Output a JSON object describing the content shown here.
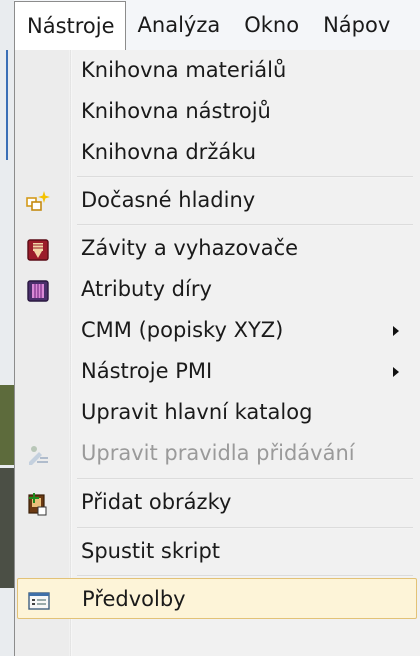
{
  "menubar": {
    "items": [
      {
        "label": "Nástroje"
      },
      {
        "label": "Analýza"
      },
      {
        "label": "Okno"
      },
      {
        "label": "Nápov"
      }
    ]
  },
  "menu": {
    "items": [
      {
        "label": "Knihovna materiálů",
        "icon": ""
      },
      {
        "label": "Knihovna nástrojů",
        "icon": ""
      },
      {
        "label": "Knihovna držáku",
        "icon": ""
      },
      {
        "label": "Dočasné hladiny",
        "icon": "temporary-layers-icon"
      },
      {
        "label": "Závity a vyhazovače",
        "icon": "threads-ejectors-icon"
      },
      {
        "label": "Atributy díry",
        "icon": "hole-attributes-icon"
      },
      {
        "label": "CMM (popisky XYZ)",
        "icon": "",
        "submenu": true
      },
      {
        "label": "Nástroje PMI",
        "icon": "",
        "submenu": true
      },
      {
        "label": "Upravit hlavní katalog",
        "icon": ""
      },
      {
        "label": "Upravit pravidla přidávání",
        "icon": "edit-add-rules-icon",
        "disabled": true
      },
      {
        "label": "Přidat obrázky",
        "icon": "add-images-icon"
      },
      {
        "label": "Spustit skript",
        "icon": ""
      },
      {
        "label": "Předvolby",
        "icon": "preferences-icon",
        "highlighted": true
      }
    ]
  },
  "colors": {
    "highlight_bg": "#fdf4d8",
    "highlight_border": "#e2c277",
    "disabled_text": "#9a9a9a"
  }
}
